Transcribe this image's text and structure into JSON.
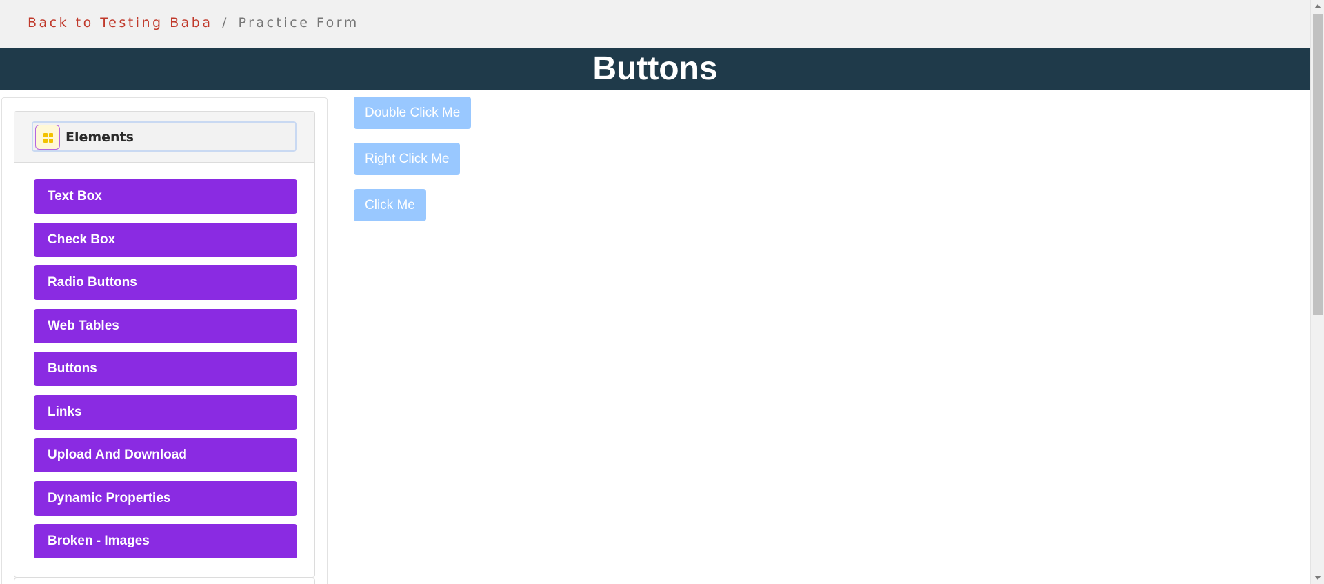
{
  "breadcrumb": {
    "link": "Back to Testing Baba",
    "separator": "/",
    "current": "Practice Form"
  },
  "header": {
    "title": "Buttons"
  },
  "sidebar": {
    "group_title": "Elements",
    "items": [
      {
        "label": "Text Box"
      },
      {
        "label": "Check Box"
      },
      {
        "label": "Radio Buttons"
      },
      {
        "label": "Web Tables"
      },
      {
        "label": "Buttons"
      },
      {
        "label": "Links"
      },
      {
        "label": "Upload And Download"
      },
      {
        "label": "Dynamic Properties"
      },
      {
        "label": "Broken - Images"
      }
    ]
  },
  "main": {
    "buttons": [
      {
        "label": "Double Click Me"
      },
      {
        "label": "Right Click Me"
      },
      {
        "label": "Click Me"
      }
    ]
  },
  "colors": {
    "breadcrumb_link": "#c0392b",
    "header_band": "#1f3a4a",
    "menu_item": "#8a2be2",
    "action_button": "#99c8ff",
    "icon_accent": "#f2c200"
  },
  "icons": {
    "group_icon": "grid-icon"
  }
}
